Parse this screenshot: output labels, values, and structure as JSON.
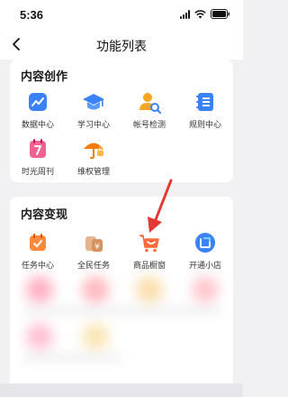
{
  "status_bar": {
    "time": "5:36"
  },
  "nav": {
    "title": "功能列表"
  },
  "sections": [
    {
      "title": "内容创作",
      "items": [
        {
          "label": "数据中心",
          "icon": "data-center-icon",
          "color": "#3b82f6"
        },
        {
          "label": "学习中心",
          "icon": "graduation-cap-icon",
          "color": "#3b82f6"
        },
        {
          "label": "帐号检测",
          "icon": "account-check-icon",
          "color": "#f5a623"
        },
        {
          "label": "规则中心",
          "icon": "rules-book-icon",
          "color": "#3b82f6"
        },
        {
          "label": "时光周刊",
          "icon": "calendar-icon",
          "color": "#f06292"
        },
        {
          "label": "维权管理",
          "icon": "umbrella-icon",
          "color": "#f57c00"
        }
      ]
    },
    {
      "title": "内容变现",
      "items": [
        {
          "label": "任务中心",
          "icon": "task-calendar-icon",
          "color": "#ff8a3d"
        },
        {
          "label": "全民任务",
          "icon": "money-bag-icon",
          "color": "#e0a070"
        },
        {
          "label": "商品橱窗",
          "icon": "shopping-cart-icon",
          "color": "#ff6a3d"
        },
        {
          "label": "开通小店",
          "icon": "shop-icon",
          "color": "#3b82f6"
        }
      ]
    }
  ],
  "annotation": {
    "arrow_color": "#e53935"
  }
}
